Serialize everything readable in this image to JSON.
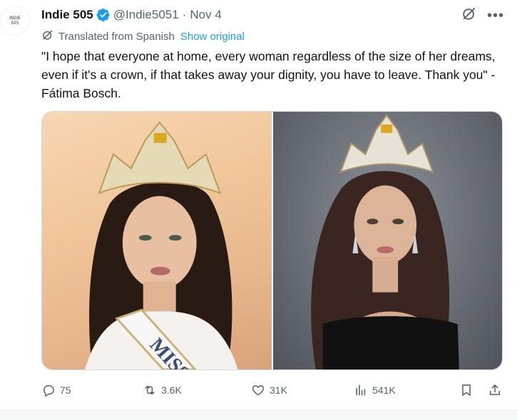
{
  "account": {
    "avatar_line1": "INDIE",
    "avatar_line2": "505",
    "name": "Indie 505",
    "handle": "@Indie5051",
    "separator": "·",
    "date": "Nov 4"
  },
  "translation": {
    "label": "Translated from Spanish",
    "link": "Show original"
  },
  "tweet": {
    "text": "\"I hope that everyone at home, every woman regardless of the size of her dreams, even if it's a crown, if that takes away your dignity, you have to leave. Thank you\" - Fátima Bosch."
  },
  "media": {
    "sash_text": "MISS"
  },
  "metrics": {
    "replies": "75",
    "reposts": "3.6K",
    "likes": "31K",
    "views": "541K"
  },
  "colors": {
    "accent": "#1d9bf0",
    "muted": "#536471",
    "text": "#0f1419"
  },
  "icons": [
    "verified-badge-icon",
    "grok-icon",
    "more-icon",
    "translate-icon",
    "reply-icon",
    "repost-icon",
    "like-icon",
    "views-icon",
    "bookmark-icon",
    "share-icon"
  ]
}
